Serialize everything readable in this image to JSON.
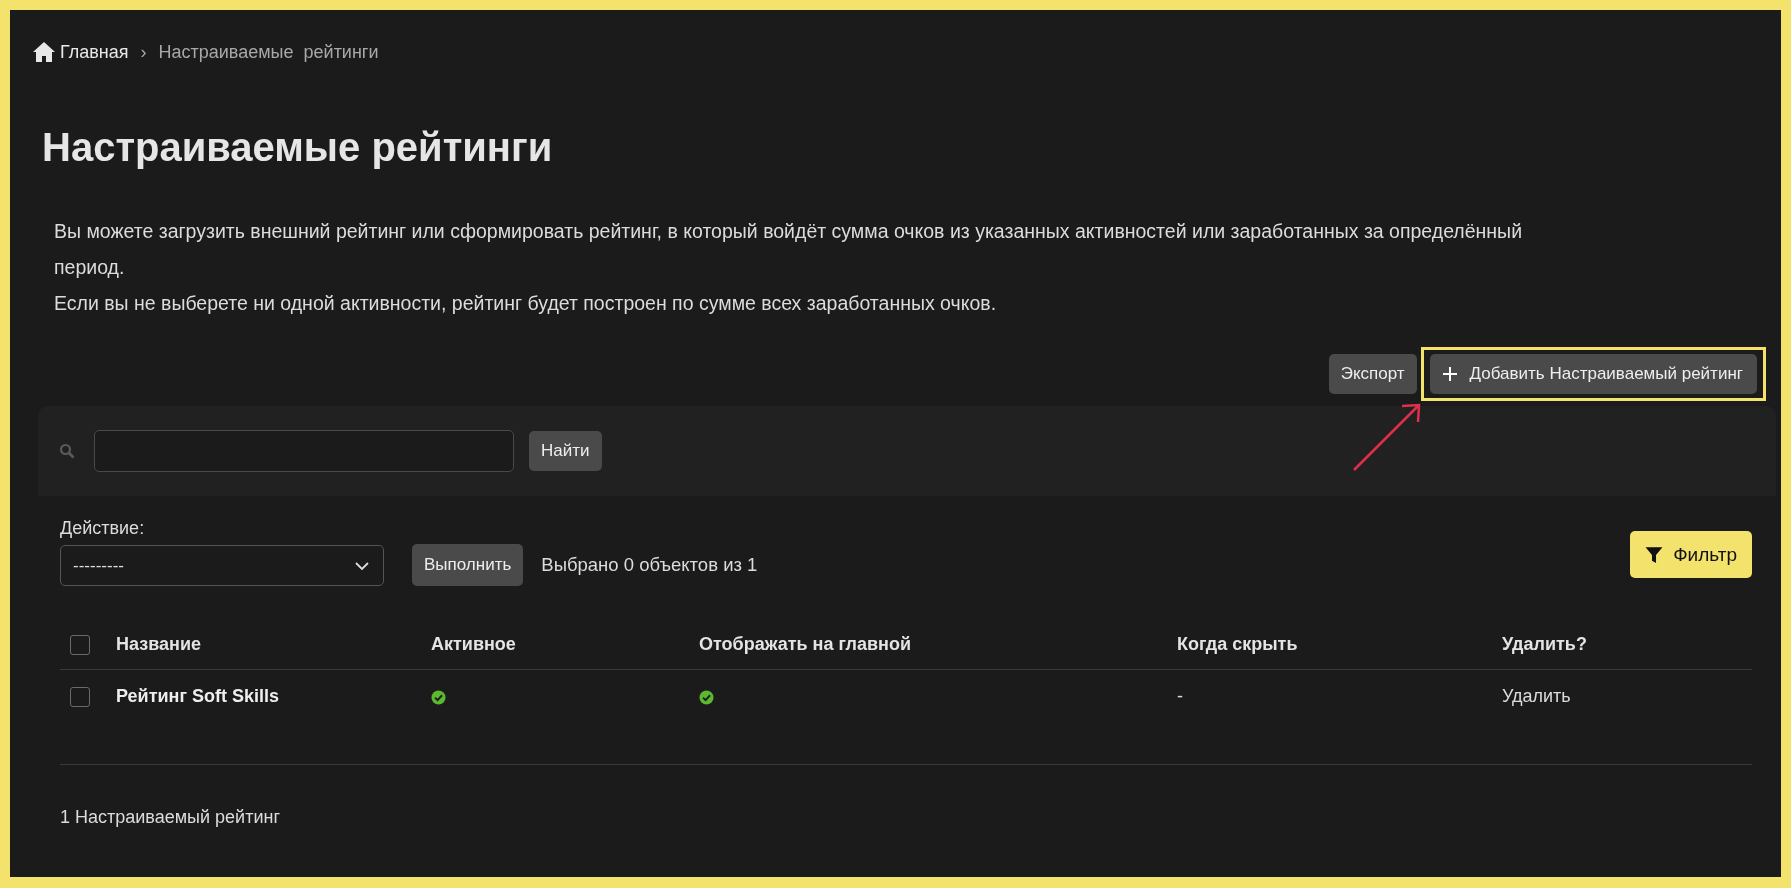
{
  "breadcrumbs": [
    {
      "label": "Главная",
      "kind": "home"
    },
    {
      "label": "Настраиваемые  рейтинги",
      "kind": "current"
    }
  ],
  "breadcrumb_separator": "›",
  "title": "Настраиваемые рейтинги",
  "description": [
    "Вы можете загрузить внешний рейтинг или сформировать рейтинг, в который войдёт сумма очков из указанных активностей или заработанных за определённый период.",
    "Если вы не выберете ни одной активности, рейтинг будет построен по сумме всех заработанных очков."
  ],
  "toolbar": {
    "export_button": "Экспорт",
    "add_button": "Добавить Настраиваемый рейтинг"
  },
  "search": {
    "button": "Найти"
  },
  "actions": {
    "label": "Действие:",
    "select_value": "---------",
    "run_button": "Выполнить",
    "selection_count": "Выбрано 0 объектов из 1"
  },
  "filter_button": "Фильтр",
  "table": {
    "select_all_checked": false,
    "columns": [
      "Название",
      "Активное",
      "Отображать на главной",
      "Когда скрыть",
      "Удалить?"
    ],
    "rows": [
      {
        "checked": false,
        "name": "Рейтинг Soft Skills",
        "active": true,
        "show_on_main": true,
        "hide_when": "-",
        "delete": "Удалить"
      }
    ]
  },
  "footer_count": "1 Настраиваемый рейтинг"
}
